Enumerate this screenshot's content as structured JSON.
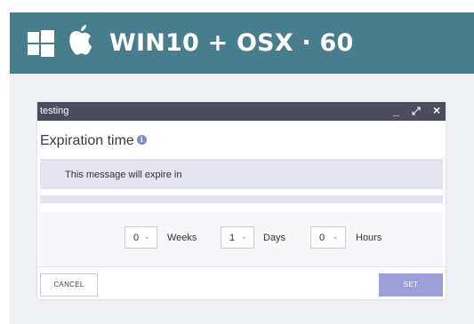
{
  "banner": {
    "brand_text": "WIN10 + OSX · 60",
    "windows_icon": "windows-logo-icon",
    "apple_icon": "apple-logo-icon",
    "background": "#477d8d"
  },
  "dialog": {
    "window_title": "testing",
    "controls": {
      "minimize": "_",
      "maximize": "⤢",
      "close": "×"
    },
    "heading": "Expiration time",
    "info_icon": "i",
    "message": "This message will expire in",
    "fields": [
      {
        "value": "0",
        "unit": "Weeks"
      },
      {
        "value": "1",
        "unit": "Days"
      },
      {
        "value": "0",
        "unit": "Hours"
      }
    ],
    "cancel_label": "CANCEL",
    "set_label": "SET",
    "accent": "#9d9fd9",
    "titlebar_color": "#4b4d5f"
  }
}
